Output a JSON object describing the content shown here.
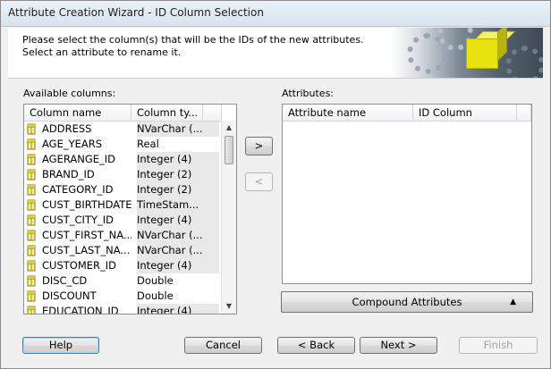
{
  "window": {
    "title": "Attribute Creation Wizard - ID Column Selection"
  },
  "banner": {
    "line1": "Please select the column(s) that will be the IDs of the new attributes.",
    "line2": "Select an attribute to rename it."
  },
  "available": {
    "label": "Available columns:",
    "headers": [
      "Column name",
      "Column ty..."
    ],
    "rows": [
      {
        "name": "ADDRESS",
        "type": "NVarChar (..."
      },
      {
        "name": "AGE_YEARS",
        "type": "Real"
      },
      {
        "name": "AGERANGE_ID",
        "type": "Integer (4)"
      },
      {
        "name": "BRAND_ID",
        "type": "Integer (2)"
      },
      {
        "name": "CATEGORY_ID",
        "type": "Integer (2)"
      },
      {
        "name": "CUST_BIRTHDATE",
        "type": "TimeStam..."
      },
      {
        "name": "CUST_CITY_ID",
        "type": "Integer (4)"
      },
      {
        "name": "CUST_FIRST_NA...",
        "type": "NVarChar (..."
      },
      {
        "name": "CUST_LAST_NA...",
        "type": "NVarChar (..."
      },
      {
        "name": "CUSTOMER_ID",
        "type": "Integer (4)"
      },
      {
        "name": "DISC_CD",
        "type": "Double"
      },
      {
        "name": "DISCOUNT",
        "type": "Double"
      },
      {
        "name": "EDUCATION_ID",
        "type": "Integer (4)"
      }
    ]
  },
  "attributes": {
    "label": "Attributes:",
    "headers": [
      "Attribute name",
      "ID Column"
    ]
  },
  "transfer": {
    "add": ">",
    "remove": "<"
  },
  "compound": {
    "label": "Compound Attributes"
  },
  "buttons": {
    "help": "Help",
    "cancel": "Cancel",
    "back": "< Back",
    "next": "Next >",
    "finish": "Finish"
  }
}
